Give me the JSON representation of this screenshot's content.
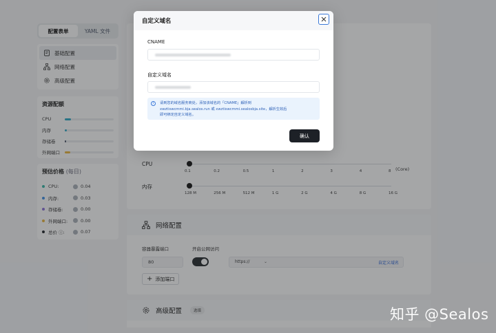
{
  "left_tabs": [
    "配置表单",
    "YAML 文件"
  ],
  "side_nav": [
    {
      "label": "基础配置",
      "icon": "doc-icon"
    },
    {
      "label": "网络配置",
      "icon": "network-icon"
    },
    {
      "label": "高级配置",
      "icon": "gear-icon"
    }
  ],
  "resources": {
    "title": "资源配额",
    "rows": [
      {
        "label": "CPU",
        "fill": 0.13,
        "color": "#2aa8c4"
      },
      {
        "label": "内存",
        "fill": 0.04,
        "color": "#2aa8c4"
      },
      {
        "label": "存储卷",
        "fill": 0.03,
        "color": "#485264"
      },
      {
        "label": "外网端口",
        "fill": 0.11,
        "color": "#e8b43c"
      }
    ]
  },
  "pricing": {
    "title": "预估价格",
    "subtitle": "(每日)",
    "rows": [
      {
        "label": "CPU:",
        "value": "0.04",
        "color": "#33b5a5"
      },
      {
        "label": "内存:",
        "value": "0.03",
        "color": "#3b8ee6"
      },
      {
        "label": "存储卷:",
        "value": "0.00",
        "color": "#8a6fd8"
      },
      {
        "label": "外网端口:",
        "value": "0.00",
        "color": "#e8b43c"
      },
      {
        "label": "总价 ⓘ:",
        "value": "0.07",
        "color": "#1d2127"
      }
    ]
  },
  "cpu_slider": {
    "label": "CPU",
    "ticks": [
      "0.1",
      "0.2",
      "0.5",
      "1",
      "2",
      "3",
      "4",
      "8"
    ],
    "unit": "(Core)"
  },
  "mem_slider": {
    "label": "内存",
    "ticks": [
      "128 M",
      "256 M",
      "512 M",
      "1 G",
      "2 G",
      "4 G",
      "8 G",
      "16 G"
    ]
  },
  "network": {
    "title": "网络配置",
    "port_label": "容器暴露端口",
    "public_label": "开启公网访问",
    "port_value": "80",
    "protocol": "https://",
    "custom_domain_link": "自定义域名",
    "add_port": "添加端口"
  },
  "advanced": {
    "title": "高级配置",
    "tag": "选填"
  },
  "modal": {
    "title": "自定义域名",
    "cname_label": "CNAME",
    "domain_label": "自定义域名",
    "tip_line1": "请到您的域名服务商处，添加该域名的「CNAME」解析到",
    "tip_line2": "xwztiswcmmi.bja.sealos.run 或 xwztiswcmmi.sealosbja.site，解析生效后",
    "tip_line3": "即可绑定自定义域名。",
    "confirm": "确认"
  },
  "watermark": "知乎 @Sealos"
}
